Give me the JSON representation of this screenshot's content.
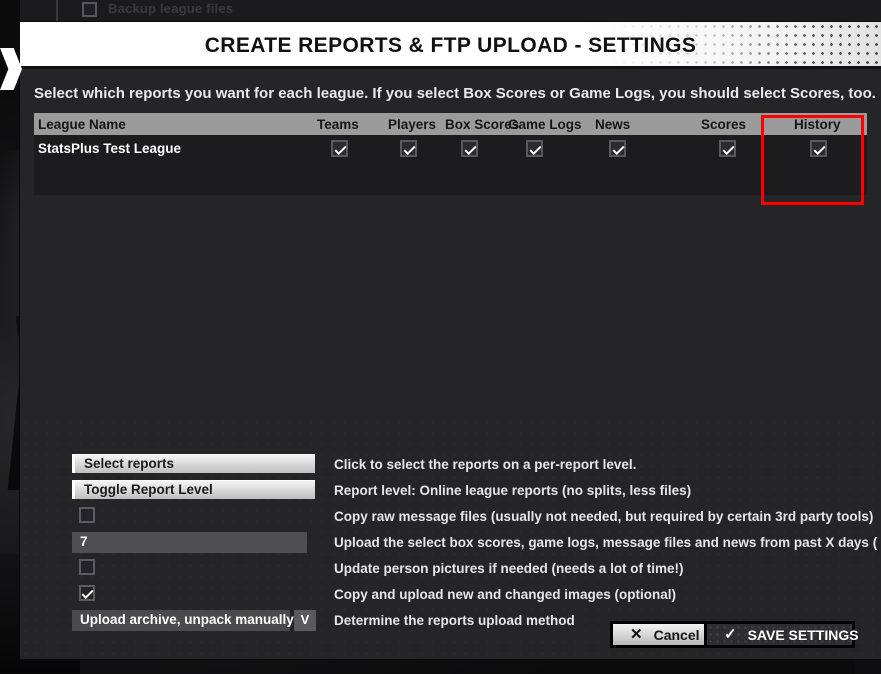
{
  "window": {
    "title": "CREATE REPORTS & FTP UPLOAD - SETTINGS",
    "chevron_icon": "chevron-left-right-icon"
  },
  "background": {
    "partial_checkbox_label": "Backup league files"
  },
  "main": {
    "intro_text": "Select which reports you want for each league. If you select Box Scores or Game Logs, you should select Scores, too.",
    "annotation_color": "#ff0000"
  },
  "table": {
    "columns": [
      "League Name",
      "Teams",
      "Players",
      "Box Scores",
      "Game Logs",
      "News",
      "Scores",
      "History"
    ],
    "rows": [
      {
        "league_name": "StatsPlus Test League",
        "teams": true,
        "players": true,
        "box_scores": true,
        "game_logs": true,
        "news": true,
        "scores": true,
        "history": true
      }
    ]
  },
  "options": [
    {
      "control": "button",
      "label": "Select reports",
      "description": "Click to select the reports on a per-report level."
    },
    {
      "control": "button",
      "label": "Toggle Report Level",
      "description": "Report level: Online league reports (no splits, less files)"
    },
    {
      "control": "checkbox",
      "checked": false,
      "description": "Copy raw message files (usually not needed, but required by certain 3rd party tools)"
    },
    {
      "control": "text",
      "value": "7",
      "description": "Upload the select box scores, game logs, message files and news from past X days ("
    },
    {
      "control": "checkbox",
      "checked": false,
      "description": "Update person pictures if needed (needs a lot of time!)"
    },
    {
      "control": "checkbox",
      "checked": true,
      "description": "Copy and upload new and changed images (optional)"
    },
    {
      "control": "select",
      "value": "Upload archive, unpack manually",
      "chevron": "V",
      "description": "Determine the reports upload method"
    }
  ],
  "footer": {
    "cancel_label": "Cancel",
    "cancel_icon": "close-icon",
    "cancel_glyph": "✕",
    "save_label": "SAVE SETTINGS",
    "save_icon": "check-icon",
    "save_glyph": "✓"
  }
}
